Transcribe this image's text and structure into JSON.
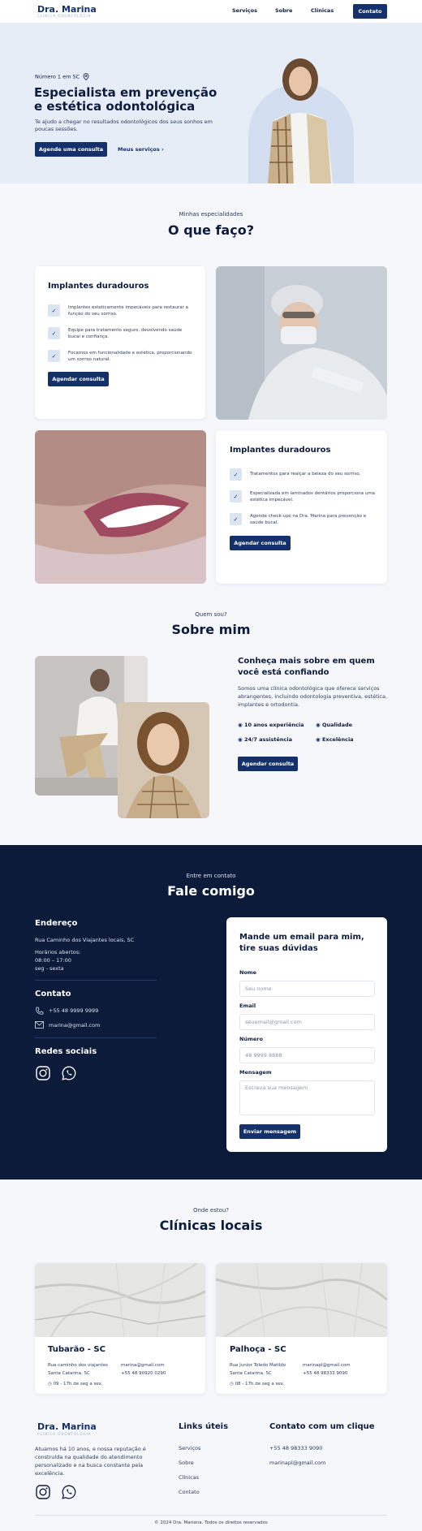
{
  "header": {
    "logo_name": "Dra. Marina",
    "logo_sub": "CLÍNICA ODONTOLÓGIA",
    "nav": [
      "Serviços",
      "Sobre",
      "Clínicas"
    ],
    "cta": "Contato"
  },
  "hero": {
    "badge": "Número 1 em SC",
    "title": "Especialista em prevenção e estética odontológica",
    "text": "Te ajudo a chegar no resultados odontológicos dos seus sonhos em poucas sessões.",
    "primary_btn": "Agende uma consulta",
    "secondary_link": "Meus serviços"
  },
  "services": {
    "kicker": "Minhas especialidades",
    "title": "O que faço?",
    "card1": {
      "title": "Implantes duradouros",
      "items": [
        "Implantes esteticamente impecáveis para restaurar a função do seu sorriso.",
        "Equipe para tratamento seguro, devolvendo saúde bucal e confiança.",
        "Focamos em funcionalidade e estética, proporcionando um sorriso natural."
      ],
      "btn": "Agendar consulta"
    },
    "card2": {
      "title": "Implantes duradouros",
      "items": [
        "Tratamentos para realçar a beleza do seu sorriso.",
        "Especializada em laminados dentários proporciona uma estética impecável.",
        "Agende check-ups na Dra. Marina para prevenção e saúde bucal."
      ],
      "btn": "Agendar consulta"
    }
  },
  "about": {
    "kicker": "Quem sou?",
    "title": "Sobre mim",
    "heading": "Conheça mais sobre em quem você está confiando",
    "text": "Somos uma clínica odontológica que oferece serviços abrangentes, incluindo odontologia preventiva, estética, implantes e ortodontia.",
    "features": [
      "10 anos experiência",
      "Qualidade",
      "24/7 assistência",
      "Excelência"
    ],
    "btn": "Agendar consulta"
  },
  "contact": {
    "kicker": "Entre em contato",
    "title": "Fale comigo",
    "address_h": "Endereço",
    "address": "Rua Caminho dos Viajantes locais, SC",
    "hours_label": "Horários abertos:",
    "hours_time": "08:00 – 17:00",
    "hours_days": "seg - sexta",
    "contact_h": "Contato",
    "phone": "+55 48 9999 9999",
    "email": "marina@gmail.com",
    "social_h": "Redes sociais",
    "form": {
      "title": "Mande um email para mim, tire suas dúvidas",
      "name_label": "Nome",
      "name_ph": "Seu nome",
      "email_label": "Email",
      "email_ph": "seuemail@gmail.com",
      "number_label": "Número",
      "number_ph": "48 9999 8888",
      "message_label": "Mensagem",
      "message_ph": "Escreva sua mensagem",
      "submit": "Enviar mensagem"
    }
  },
  "clinics": {
    "kicker": "Onde estou?",
    "title": "Clínicas locais",
    "list": [
      {
        "name": "Tubarão - SC",
        "street": "Rua caminho dos viajantes",
        "city": "Santa Catarina, SC",
        "email": "marina@gmail.com",
        "phone": "+55 48 90920 0290",
        "hours": "09 - 17h de seg a sex."
      },
      {
        "name": "Palhoça - SC",
        "street": "Rua Junior Toledo Matildo",
        "city": "Santa Catarina, SC",
        "email": "marinapl@gmail.com",
        "phone": "+55 48 98333 9090",
        "hours": "08 - 17h de seg a sex."
      }
    ]
  },
  "footer": {
    "logo_name": "Dra. Marina",
    "logo_sub": "CLÍNICA ODONTOLÓGIA",
    "about": "Atuamos há 10 anos, e nossa reputação é construída na qualidade do atendimento personalizado e na busca constante pela excelência.",
    "links_h": "Links úteis",
    "links": [
      "Serviços",
      "Sobre",
      "Clínicas",
      "Contato"
    ],
    "contact_h": "Contato com um clique",
    "phone": "+55 48 98333 9090",
    "email": "marinapl@gmail.com",
    "copyright": "© 2024 Dra. Mariana. Todos os direitos reservados"
  },
  "colors": {
    "primary": "#14316b",
    "dark_bg": "#0c1b3a",
    "hero_bg": "#e6edf7"
  }
}
